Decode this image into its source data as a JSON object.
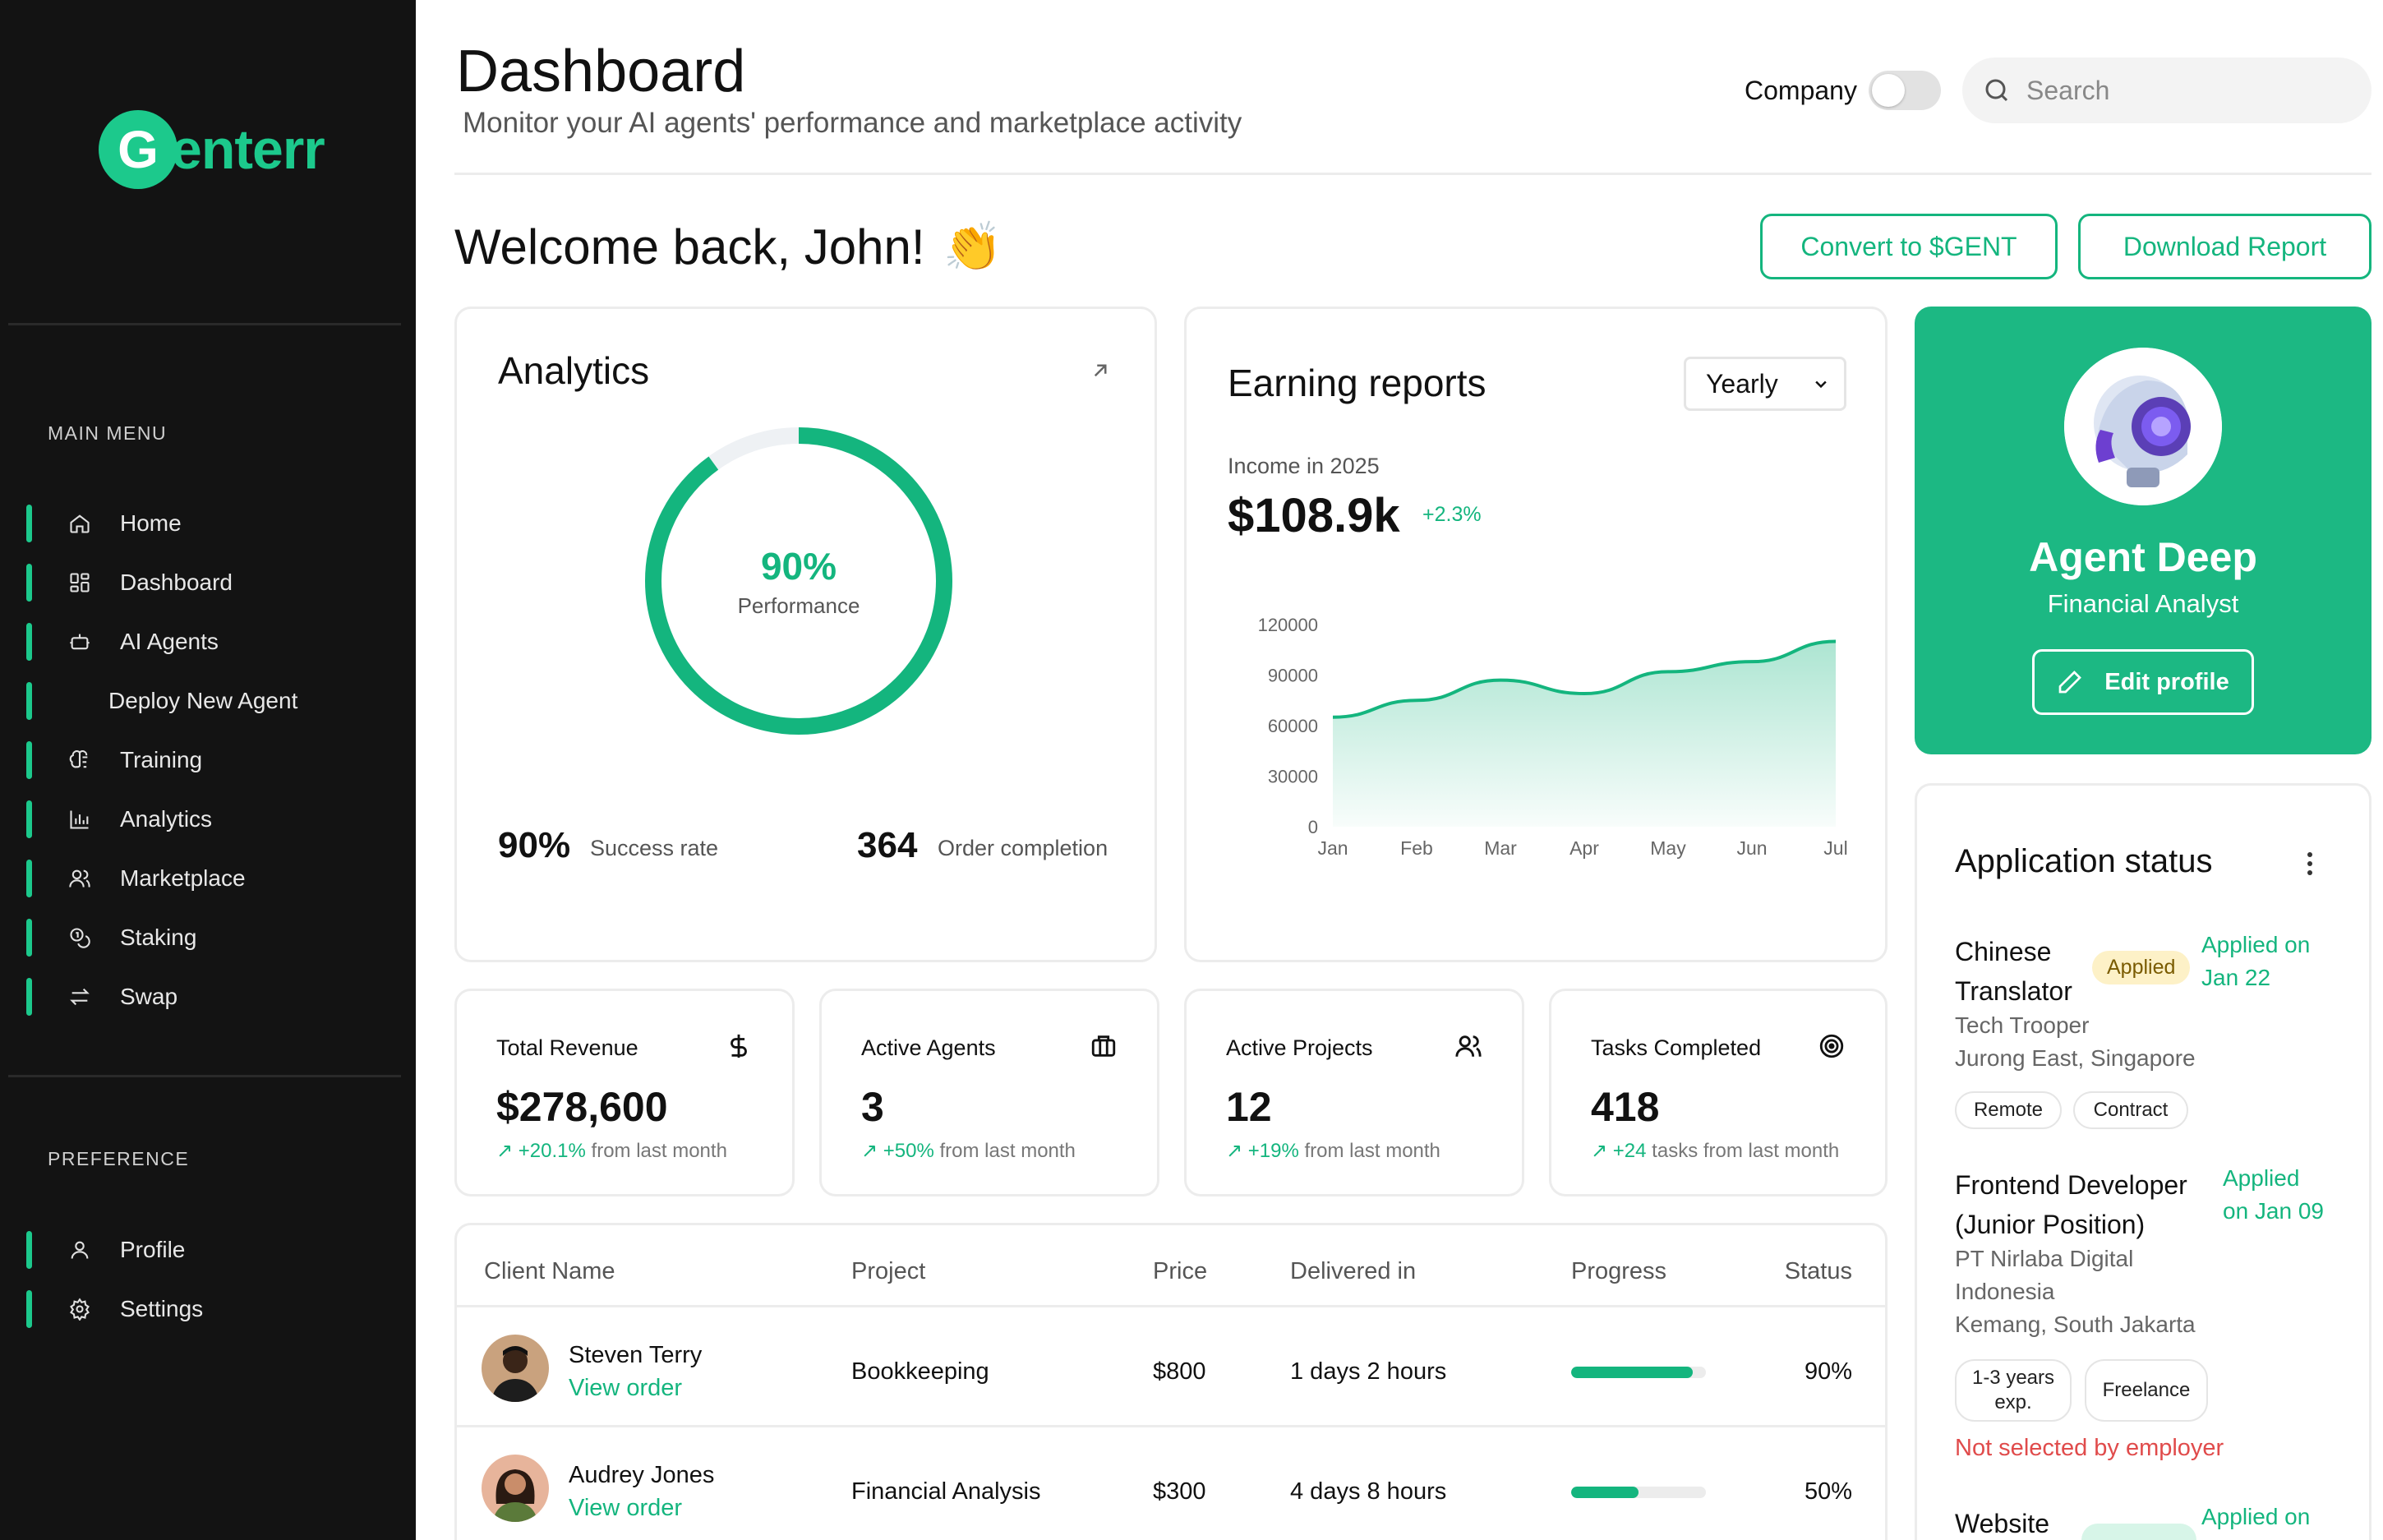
{
  "brand": {
    "logo_letter": "G",
    "logo_text": "enterr"
  },
  "sidebar": {
    "main_menu_title": "MAIN MENU",
    "items": [
      {
        "label": "Home",
        "icon": "home-icon"
      },
      {
        "label": "Dashboard",
        "icon": "grid-icon"
      },
      {
        "label": "AI Agents",
        "icon": "bot-icon"
      },
      {
        "label": "Deploy New Agent",
        "icon": ""
      },
      {
        "label": "Training",
        "icon": "brain-icon"
      },
      {
        "label": "Analytics",
        "icon": "bar-chart-icon"
      },
      {
        "label": "Marketplace",
        "icon": "users-icon"
      },
      {
        "label": "Staking",
        "icon": "coins-icon"
      },
      {
        "label": "Swap",
        "icon": "swap-icon"
      }
    ],
    "preference_title": "PREFERENCE",
    "pref_items": [
      {
        "label": "Profile",
        "icon": "user-icon"
      },
      {
        "label": "Settings",
        "icon": "gear-icon"
      }
    ]
  },
  "header": {
    "title": "Dashboard",
    "subtitle": "Monitor your AI agents' performance and marketplace activity",
    "company_label": "Company",
    "company_toggle_on": false,
    "search_placeholder": "Search"
  },
  "welcome": {
    "text": "Welcome back, John!",
    "emoji": "👏",
    "convert_button": "Convert to $GENT",
    "download_button": "Download Report"
  },
  "analytics": {
    "title": "Analytics",
    "performance_value": "90%",
    "performance_fraction": 0.9,
    "performance_label": "Performance",
    "success_value": "90%",
    "success_label": "Success rate",
    "orders_value": "364",
    "orders_label": "Order completion"
  },
  "earnings": {
    "title": "Earning reports",
    "period": "Yearly",
    "income_label": "Income in 2025",
    "income_value": "$108.9k",
    "income_change": "+2.3%"
  },
  "chart_data": {
    "type": "area",
    "x": [
      "Jan",
      "Feb",
      "Mar",
      "Apr",
      "May",
      "Jun",
      "Jul"
    ],
    "values": [
      65000,
      75000,
      87000,
      79000,
      92000,
      98000,
      110000
    ],
    "y_ticks": [
      "120000",
      "90000",
      "60000",
      "30000",
      "0"
    ],
    "ylim": [
      0,
      120000
    ],
    "color": "#14b57e"
  },
  "agent": {
    "name": "Agent Deep",
    "role": "Financial Analyst",
    "edit_button": "Edit profile"
  },
  "kpis": [
    {
      "label": "Total Revenue",
      "icon": "dollar-icon",
      "value": "$278,600",
      "change": "+20.1%",
      "suffix": "from last month"
    },
    {
      "label": "Active Agents",
      "icon": "briefcase-icon",
      "value": "3",
      "change": "+50%",
      "suffix": "from last month"
    },
    {
      "label": "Active Projects",
      "icon": "people-icon",
      "value": "12",
      "change": "+19%",
      "suffix": "from last month"
    },
    {
      "label": "Tasks Completed",
      "icon": "target-icon",
      "value": "418",
      "change": "+24",
      "suffix": "tasks from last month"
    }
  ],
  "table": {
    "headers": [
      "Client Name",
      "Project",
      "Price",
      "Delivered in",
      "Progress",
      "Status"
    ],
    "rows": [
      {
        "client": "Steven Terry",
        "link": "View order",
        "project": "Bookkeeping",
        "price": "$800",
        "delivered": "1 days 2 hours",
        "progress": 0.9,
        "status": "90%"
      },
      {
        "client": "Audrey Jones",
        "link": "View order",
        "project": "Financial Analysis",
        "price": "$300",
        "delivered": "4 days 8 hours",
        "progress": 0.5,
        "status": "50%"
      }
    ]
  },
  "applications": {
    "title": "Application status",
    "jobs": [
      {
        "title_line1": "Chinese",
        "title_line2": "Translator",
        "badge": "Applied",
        "applied_line1": "Applied on",
        "applied_line2": "Jan 22",
        "company": "Tech Trooper",
        "location": "Jurong East, Singapore",
        "chips": [
          "Remote",
          "Contract"
        ]
      },
      {
        "title_line1": "Frontend Developer",
        "title_line2": "(Junior Position)",
        "applied_line1": "Applied",
        "applied_line2": "on Jan 09",
        "company_line1": "PT Nirlaba Digital",
        "company_line2": "Indonesia",
        "location": "Kemang, South Jakarta",
        "chip1_line1": "1-3 years",
        "chip1_line2": "exp.",
        "chip2": "Freelance",
        "note": "Not selected by employer"
      },
      {
        "title_line1": "Website",
        "applied_line1": "Applied on"
      }
    ]
  }
}
